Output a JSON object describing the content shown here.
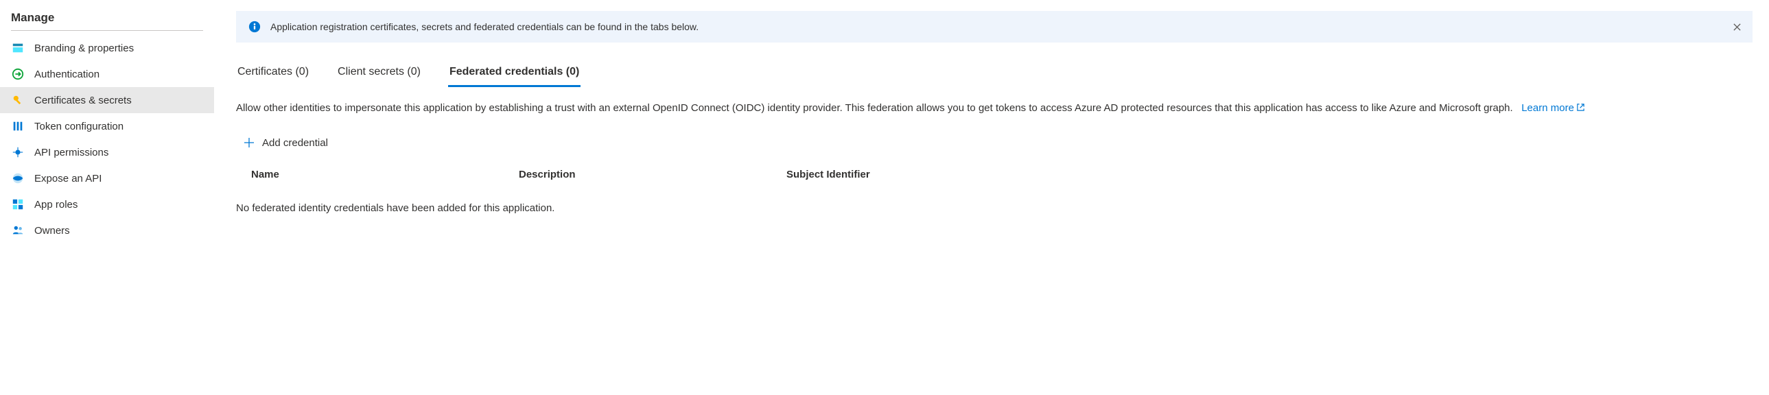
{
  "sidebar": {
    "heading": "Manage",
    "items": [
      {
        "label": "Branding & properties",
        "icon": "branding-icon",
        "active": false
      },
      {
        "label": "Authentication",
        "icon": "auth-icon",
        "active": false
      },
      {
        "label": "Certificates & secrets",
        "icon": "key-icon",
        "active": true
      },
      {
        "label": "Token configuration",
        "icon": "token-icon",
        "active": false
      },
      {
        "label": "API permissions",
        "icon": "api-perm-icon",
        "active": false
      },
      {
        "label": "Expose an API",
        "icon": "expose-api-icon",
        "active": false
      },
      {
        "label": "App roles",
        "icon": "app-roles-icon",
        "active": false
      },
      {
        "label": "Owners",
        "icon": "owners-icon",
        "active": false
      }
    ]
  },
  "banner": {
    "text": "Application registration certificates, secrets and federated credentials can be found in the tabs below."
  },
  "tabs": [
    {
      "label": "Certificates (0)",
      "active": false
    },
    {
      "label": "Client secrets (0)",
      "active": false
    },
    {
      "label": "Federated credentials (0)",
      "active": true
    }
  ],
  "description": {
    "text": "Allow other identities to impersonate this application by establishing a trust with an external OpenID Connect (OIDC) identity provider. This federation allows you to get tokens to access Azure AD protected resources that this application has access to like Azure and Microsoft graph.",
    "learn_more": "Learn more"
  },
  "add_credential_label": "Add credential",
  "table": {
    "columns": {
      "name": "Name",
      "description": "Description",
      "subject": "Subject Identifier"
    },
    "empty": "No federated identity credentials have been added for this application."
  }
}
